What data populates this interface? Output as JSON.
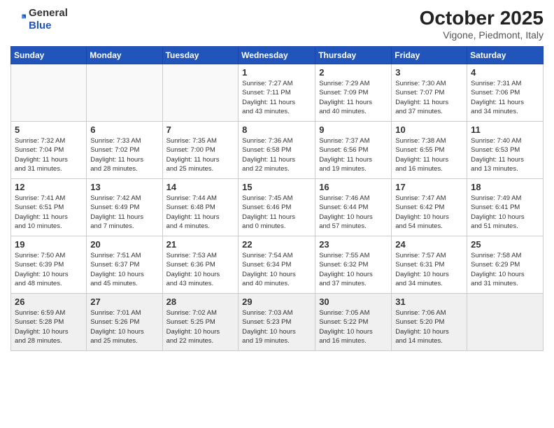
{
  "header": {
    "logo_general": "General",
    "logo_blue": "Blue",
    "month_title": "October 2025",
    "location": "Vigone, Piedmont, Italy"
  },
  "weekdays": [
    "Sunday",
    "Monday",
    "Tuesday",
    "Wednesday",
    "Thursday",
    "Friday",
    "Saturday"
  ],
  "weeks": [
    [
      {
        "day": "",
        "info": ""
      },
      {
        "day": "",
        "info": ""
      },
      {
        "day": "",
        "info": ""
      },
      {
        "day": "1",
        "info": "Sunrise: 7:27 AM\nSunset: 7:11 PM\nDaylight: 11 hours\nand 43 minutes."
      },
      {
        "day": "2",
        "info": "Sunrise: 7:29 AM\nSunset: 7:09 PM\nDaylight: 11 hours\nand 40 minutes."
      },
      {
        "day": "3",
        "info": "Sunrise: 7:30 AM\nSunset: 7:07 PM\nDaylight: 11 hours\nand 37 minutes."
      },
      {
        "day": "4",
        "info": "Sunrise: 7:31 AM\nSunset: 7:06 PM\nDaylight: 11 hours\nand 34 minutes."
      }
    ],
    [
      {
        "day": "5",
        "info": "Sunrise: 7:32 AM\nSunset: 7:04 PM\nDaylight: 11 hours\nand 31 minutes."
      },
      {
        "day": "6",
        "info": "Sunrise: 7:33 AM\nSunset: 7:02 PM\nDaylight: 11 hours\nand 28 minutes."
      },
      {
        "day": "7",
        "info": "Sunrise: 7:35 AM\nSunset: 7:00 PM\nDaylight: 11 hours\nand 25 minutes."
      },
      {
        "day": "8",
        "info": "Sunrise: 7:36 AM\nSunset: 6:58 PM\nDaylight: 11 hours\nand 22 minutes."
      },
      {
        "day": "9",
        "info": "Sunrise: 7:37 AM\nSunset: 6:56 PM\nDaylight: 11 hours\nand 19 minutes."
      },
      {
        "day": "10",
        "info": "Sunrise: 7:38 AM\nSunset: 6:55 PM\nDaylight: 11 hours\nand 16 minutes."
      },
      {
        "day": "11",
        "info": "Sunrise: 7:40 AM\nSunset: 6:53 PM\nDaylight: 11 hours\nand 13 minutes."
      }
    ],
    [
      {
        "day": "12",
        "info": "Sunrise: 7:41 AM\nSunset: 6:51 PM\nDaylight: 11 hours\nand 10 minutes."
      },
      {
        "day": "13",
        "info": "Sunrise: 7:42 AM\nSunset: 6:49 PM\nDaylight: 11 hours\nand 7 minutes."
      },
      {
        "day": "14",
        "info": "Sunrise: 7:44 AM\nSunset: 6:48 PM\nDaylight: 11 hours\nand 4 minutes."
      },
      {
        "day": "15",
        "info": "Sunrise: 7:45 AM\nSunset: 6:46 PM\nDaylight: 11 hours\nand 0 minutes."
      },
      {
        "day": "16",
        "info": "Sunrise: 7:46 AM\nSunset: 6:44 PM\nDaylight: 10 hours\nand 57 minutes."
      },
      {
        "day": "17",
        "info": "Sunrise: 7:47 AM\nSunset: 6:42 PM\nDaylight: 10 hours\nand 54 minutes."
      },
      {
        "day": "18",
        "info": "Sunrise: 7:49 AM\nSunset: 6:41 PM\nDaylight: 10 hours\nand 51 minutes."
      }
    ],
    [
      {
        "day": "19",
        "info": "Sunrise: 7:50 AM\nSunset: 6:39 PM\nDaylight: 10 hours\nand 48 minutes."
      },
      {
        "day": "20",
        "info": "Sunrise: 7:51 AM\nSunset: 6:37 PM\nDaylight: 10 hours\nand 45 minutes."
      },
      {
        "day": "21",
        "info": "Sunrise: 7:53 AM\nSunset: 6:36 PM\nDaylight: 10 hours\nand 43 minutes."
      },
      {
        "day": "22",
        "info": "Sunrise: 7:54 AM\nSunset: 6:34 PM\nDaylight: 10 hours\nand 40 minutes."
      },
      {
        "day": "23",
        "info": "Sunrise: 7:55 AM\nSunset: 6:32 PM\nDaylight: 10 hours\nand 37 minutes."
      },
      {
        "day": "24",
        "info": "Sunrise: 7:57 AM\nSunset: 6:31 PM\nDaylight: 10 hours\nand 34 minutes."
      },
      {
        "day": "25",
        "info": "Sunrise: 7:58 AM\nSunset: 6:29 PM\nDaylight: 10 hours\nand 31 minutes."
      }
    ],
    [
      {
        "day": "26",
        "info": "Sunrise: 6:59 AM\nSunset: 5:28 PM\nDaylight: 10 hours\nand 28 minutes."
      },
      {
        "day": "27",
        "info": "Sunrise: 7:01 AM\nSunset: 5:26 PM\nDaylight: 10 hours\nand 25 minutes."
      },
      {
        "day": "28",
        "info": "Sunrise: 7:02 AM\nSunset: 5:25 PM\nDaylight: 10 hours\nand 22 minutes."
      },
      {
        "day": "29",
        "info": "Sunrise: 7:03 AM\nSunset: 5:23 PM\nDaylight: 10 hours\nand 19 minutes."
      },
      {
        "day": "30",
        "info": "Sunrise: 7:05 AM\nSunset: 5:22 PM\nDaylight: 10 hours\nand 16 minutes."
      },
      {
        "day": "31",
        "info": "Sunrise: 7:06 AM\nSunset: 5:20 PM\nDaylight: 10 hours\nand 14 minutes."
      },
      {
        "day": "",
        "info": ""
      }
    ]
  ]
}
